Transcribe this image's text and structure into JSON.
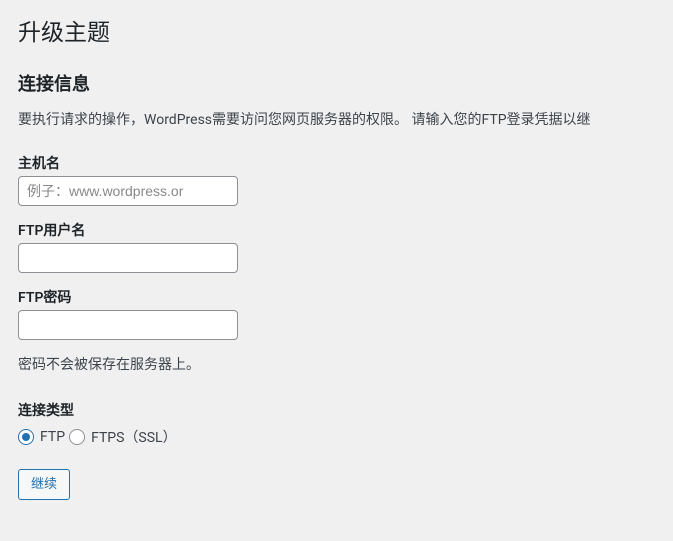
{
  "page": {
    "title": "升级主题"
  },
  "section": {
    "heading": "连接信息",
    "description": "要执行请求的操作，WordPress需要访问您网页服务器的权限。 请输入您的FTP登录凭据以继"
  },
  "fields": {
    "hostname": {
      "label": "主机名",
      "placeholder": "例子：www.wordpress.or",
      "value": ""
    },
    "username": {
      "label": "FTP用户名",
      "value": ""
    },
    "password": {
      "label": "FTP密码",
      "value": "",
      "help": "密码不会被保存在服务器上。"
    },
    "connection_type": {
      "label": "连接类型",
      "options": {
        "ftp": "FTP",
        "ftps": "FTPS（SSL）"
      },
      "selected": "ftp"
    }
  },
  "actions": {
    "submit": "继续"
  }
}
